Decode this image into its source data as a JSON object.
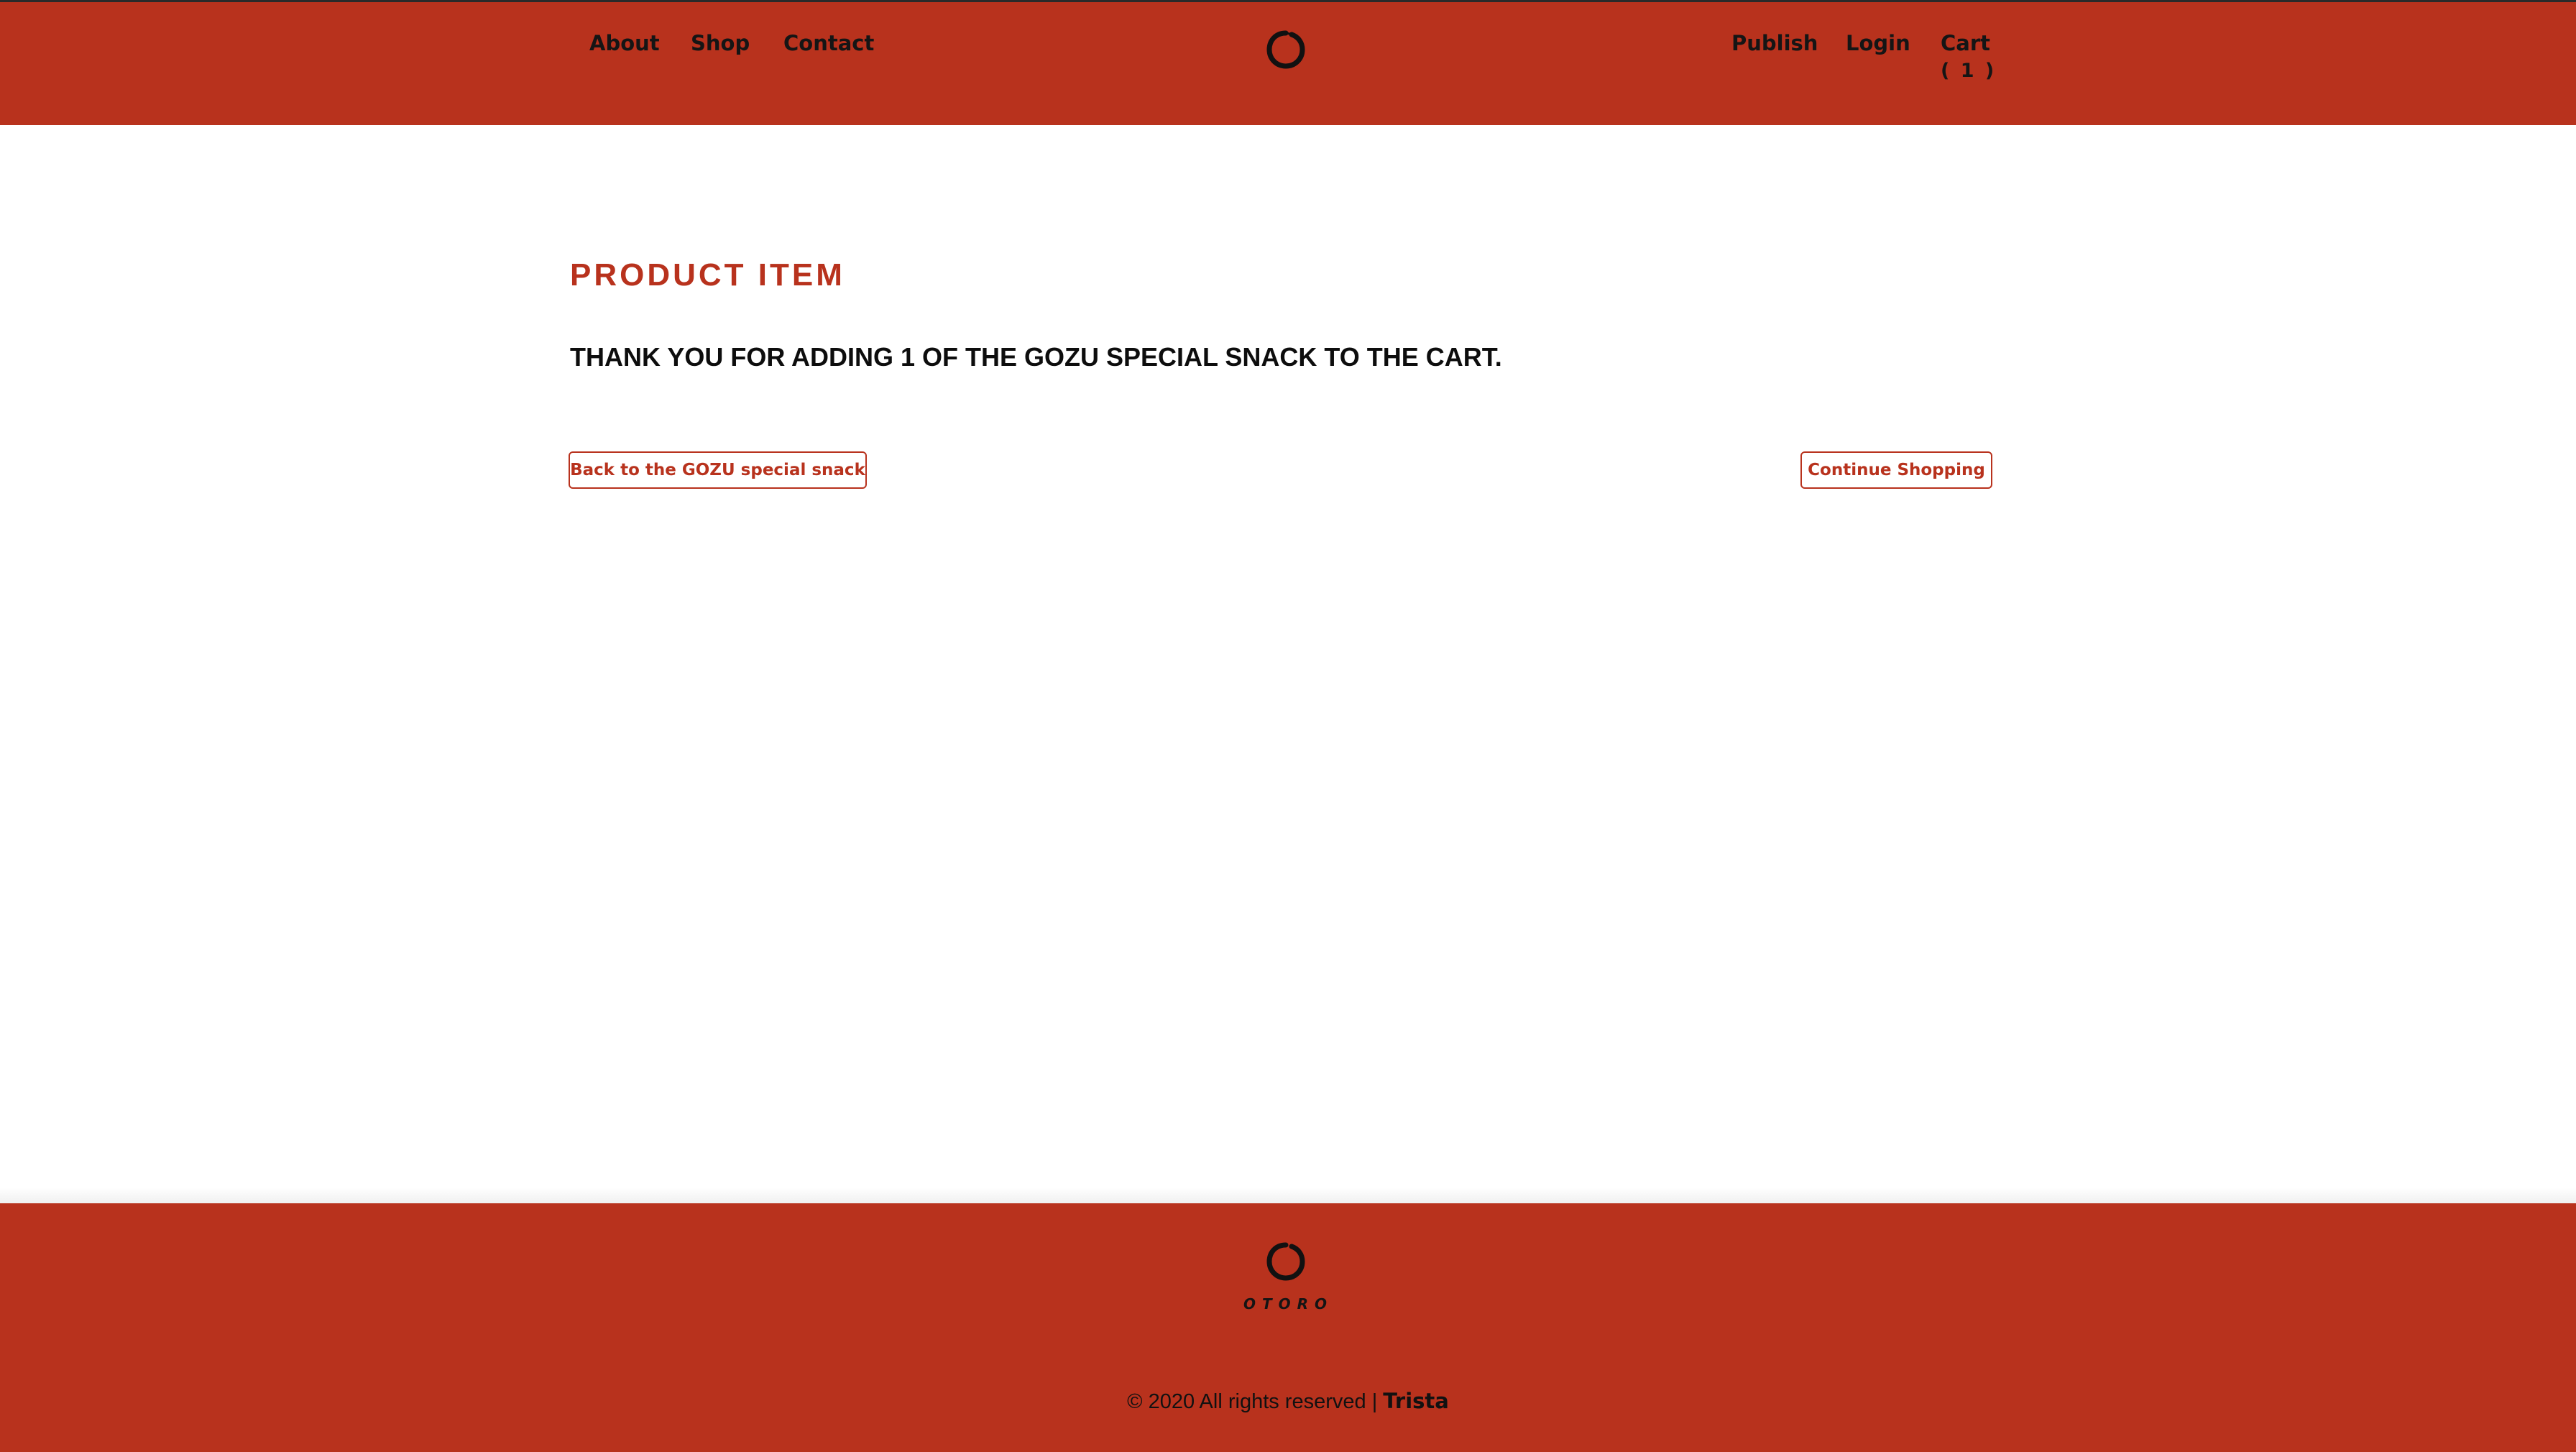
{
  "header": {
    "nav_left": [
      {
        "label": "About"
      },
      {
        "label": "Shop"
      },
      {
        "label": "Contact"
      }
    ],
    "nav_right": {
      "publish": "Publish",
      "login": "Login",
      "cart": "Cart",
      "cart_count": "( 1 )"
    },
    "logo_icon": "ensō-circle-icon"
  },
  "main": {
    "title": "PRODUCT ITEM",
    "message": "THANK YOU FOR ADDING 1 OF THE GOZU SPECIAL SNACK TO THE CART.",
    "back_button": "Back to the GOZU special snack",
    "continue_button": "Continue Shopping"
  },
  "footer": {
    "logo_icon": "ensō-circle-icon",
    "wordmark": "OTORO",
    "copyright_prefix": "© 2020 All rights reserved | ",
    "author": "Trista"
  },
  "colors": {
    "brand_red": "#b8321d",
    "text_dark": "#111111",
    "background": "#ffffff"
  }
}
